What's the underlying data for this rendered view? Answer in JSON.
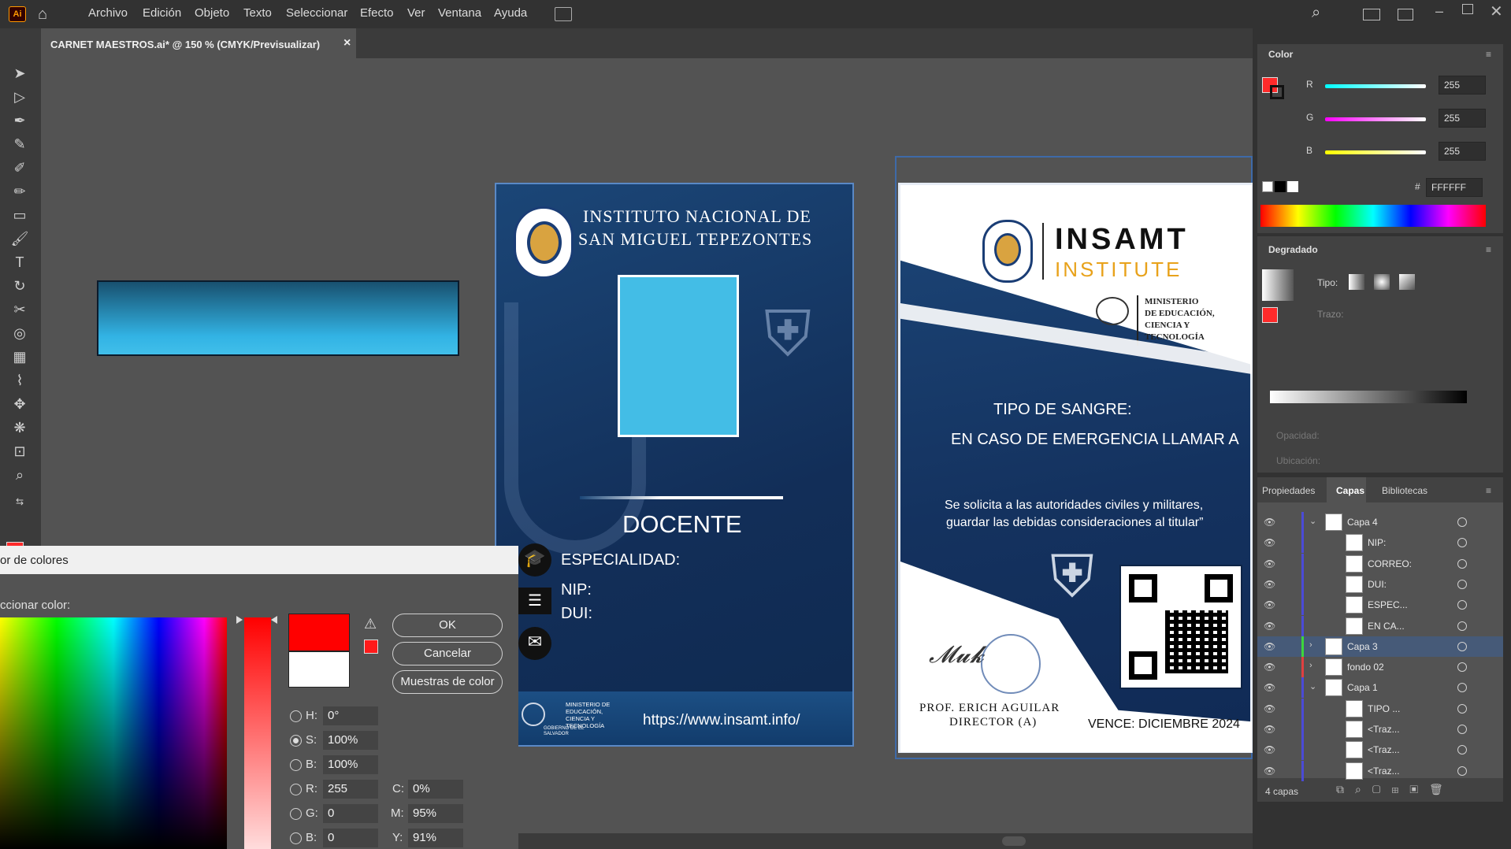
{
  "app": {
    "logo": "Ai"
  },
  "menu": [
    "Archivo",
    "Edición",
    "Objeto",
    "Texto",
    "Seleccionar",
    "Efecto",
    "Ver",
    "Ventana",
    "Ayuda"
  ],
  "document_tab": {
    "title": "CARNET MAESTROS.ai* @ 150 % (CMYK/Previsualizar)",
    "close": "×"
  },
  "color_panel": {
    "title": "Color",
    "channels": [
      {
        "label": "R",
        "value": "255"
      },
      {
        "label": "G",
        "value": "255"
      },
      {
        "label": "B",
        "value": "255"
      }
    ],
    "hex_label": "#",
    "hex": "FFFFFF"
  },
  "gradient_panel": {
    "title": "Degradado",
    "type_label": "Tipo:",
    "stroke_label": "Trazo:",
    "opacity_label": "Opacidad:",
    "location_label": "Ubicación:"
  },
  "layers_panel": {
    "tabs": [
      "Propiedades",
      "Capas",
      "Bibliotecas"
    ],
    "rows": [
      {
        "name": "Capa 4",
        "indent": 0,
        "expanded": true
      },
      {
        "name": "NIP:",
        "indent": 1
      },
      {
        "name": "CORREO:",
        "indent": 1
      },
      {
        "name": "DUI:",
        "indent": 1
      },
      {
        "name": "ESPEC...",
        "indent": 1
      },
      {
        "name": "EN CA...",
        "indent": 1
      },
      {
        "name": "Capa 3",
        "indent": 0,
        "expanded": false
      },
      {
        "name": "fondo 02",
        "indent": 0,
        "expanded": false
      },
      {
        "name": "Capa 1",
        "indent": 0,
        "expanded": true
      },
      {
        "name": "TIPO ...",
        "indent": 1
      },
      {
        "name": "<Traz...",
        "indent": 1
      },
      {
        "name": "<Traz...",
        "indent": 1
      },
      {
        "name": "<Traz...",
        "indent": 1
      }
    ],
    "footer": "4 capas"
  },
  "color_dialog": {
    "title": "or de colores",
    "select_label": "ccionar color:",
    "buttons": {
      "ok": "OK",
      "cancel": "Cancelar",
      "swatches": "Muestras de color"
    },
    "fields": {
      "H": {
        "label": "H:",
        "value": "0°"
      },
      "S": {
        "label": "S:",
        "value": "100%"
      },
      "Bv": {
        "label": "B:",
        "value": "100%"
      },
      "R": {
        "label": "R:",
        "value": "255"
      },
      "G": {
        "label": "G:",
        "value": "0"
      },
      "B": {
        "label": "B:",
        "value": "0"
      },
      "C": {
        "label": "C:",
        "value": "0%"
      },
      "M": {
        "label": "M:",
        "value": "95%"
      },
      "Y": {
        "label": "Y:",
        "value": "91%"
      }
    }
  },
  "front_card": {
    "institution_line1": "INSTITUTO NACIONAL DE",
    "institution_line2": "SAN MIGUEL TEPEZONTES",
    "role": "DOCENTE",
    "specialty": "ESPECIALIDAD:",
    "nip": "NIP:",
    "dui": "DUI:",
    "ministry": "MINISTERIO DE EDUCACIÓN, CIENCIA Y TECNOLOGÍA",
    "gov": "GOBIERNO DE EL SALVADOR",
    "url": "https://www.insamt.info/"
  },
  "back_card": {
    "brand_line1": "INSAMT",
    "brand_line2": "INSTITUTE",
    "ministry_line1": "MINISTERIO",
    "ministry_line2": "DE EDUCACIÓN,",
    "ministry_line3": "CIENCIA Y",
    "ministry_line4": "TECNOLOGÍA",
    "blood": "TIPO DE SANGRE:",
    "emergency": "EN CASO DE EMERGENCIA LLAMAR A",
    "request_line1": "Se solicita a las autoridades civiles y militares,",
    "request_line2": "guardar las debidas consideraciones al titular”",
    "signer": "PROF. ERICH AGUILAR",
    "signer_title": "DIRECTOR (A)",
    "expires": "VENCE: DICIEMBRE 2024"
  },
  "colors": {
    "accent_red": "#ff0000",
    "card_navy": "#163d6a",
    "photo_blue": "#43bde6"
  }
}
